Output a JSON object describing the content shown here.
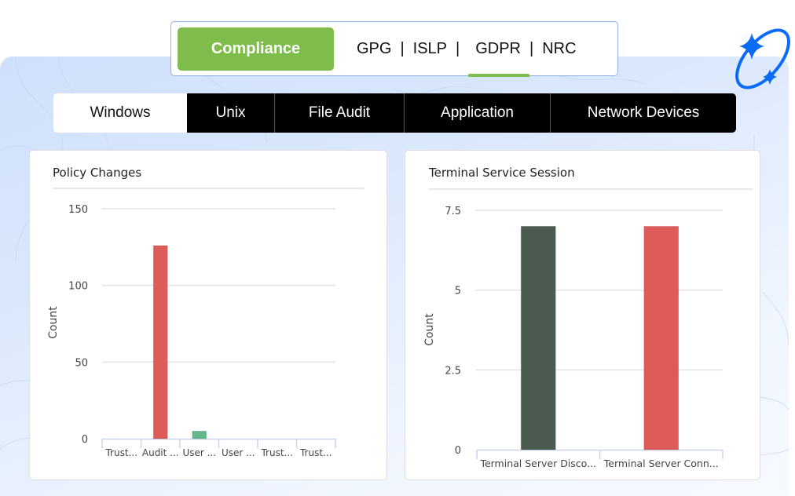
{
  "header": {
    "compliance_label": "Compliance",
    "regulations": [
      "GPG",
      "ISLP",
      "GDPR",
      "NRC"
    ],
    "separator": "|",
    "active_regulation": "GDPR",
    "accent_color": "#7ebc4b"
  },
  "tabs": [
    {
      "label": "Windows",
      "active": true
    },
    {
      "label": "Unix",
      "active": false
    },
    {
      "label": "File Audit",
      "active": false
    },
    {
      "label": "Application",
      "active": false
    },
    {
      "label": "Network Devices",
      "active": false
    }
  ],
  "decor": {
    "icon": "sparkle-orbit-icon",
    "color": "#0a6cf5"
  },
  "chart_data": [
    {
      "type": "bar",
      "title": "Policy Changes",
      "xlabel": "",
      "ylabel": "Count",
      "ylim": [
        0,
        150
      ],
      "yticks": [
        0,
        50,
        100,
        150
      ],
      "categories": [
        "Trust...",
        "Audit ...",
        "User ...",
        "User ...",
        "Trust...",
        "Trust..."
      ],
      "values": [
        0,
        126,
        5,
        0,
        0,
        0
      ],
      "colors": [
        "#dd5c5a",
        "#dd5c5a",
        "#63b98a",
        "#dd5c5a",
        "#dd5c5a",
        "#dd5c5a"
      ],
      "grid": true,
      "legend": "none"
    },
    {
      "type": "bar",
      "title": "Terminal Service Session",
      "xlabel": "",
      "ylabel": "Count",
      "ylim": [
        0,
        7.5
      ],
      "yticks": [
        0,
        2.5,
        5,
        7.5
      ],
      "ytick_labels": [
        "0",
        "2.5",
        "5",
        "7.5"
      ],
      "categories": [
        "Terminal Server Disco...",
        "Terminal Server Conn..."
      ],
      "values": [
        7,
        7
      ],
      "colors": [
        "#4a5a4f",
        "#dd5c5a"
      ],
      "grid": true,
      "legend": "none"
    }
  ]
}
